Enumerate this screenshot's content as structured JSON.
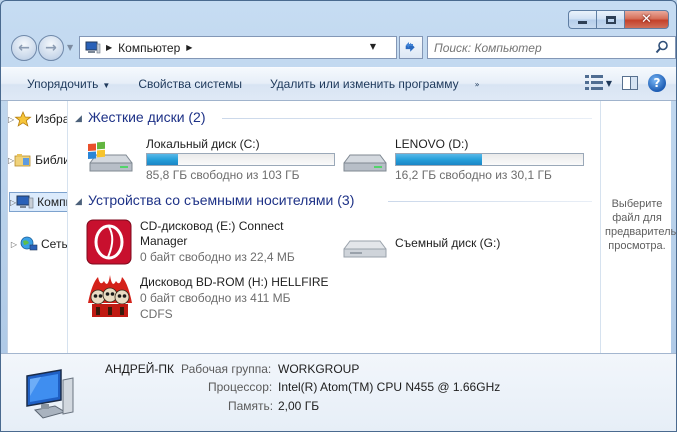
{
  "window": {
    "close_glyph": "✕"
  },
  "nav": {
    "address_text": "Компьютер",
    "search_placeholder": "Поиск: Компьютер"
  },
  "toolbar": {
    "organize": "Упорядочить",
    "system_properties": "Свойства системы",
    "uninstall": "Удалить или изменить программу"
  },
  "sidebar": {
    "items": [
      {
        "label": "Избранное",
        "icon": "star-icon"
      },
      {
        "label": "Библиотеки",
        "icon": "libraries-icon"
      },
      {
        "label": "Компьютер",
        "icon": "computer-icon",
        "selected": true
      },
      {
        "label": "Сеть",
        "icon": "network-icon"
      }
    ]
  },
  "groups": {
    "hard_drives": {
      "title": "Жесткие диски (2)",
      "drives": [
        {
          "name": "Локальный диск (C:)",
          "free": "85,8 ГБ свободно из 103 ГБ",
          "used_fraction": 0.167,
          "icon": "windows-drive-icon"
        },
        {
          "name": "LENOVO (D:)",
          "free": "16,2 ГБ свободно из 30,1 ГБ",
          "used_fraction": 0.462,
          "icon": "hard-drive-icon"
        }
      ]
    },
    "removable": {
      "title": "Устройства со съемными носителями (3)",
      "devices": [
        {
          "name_line1": "CD-дисковод (E:) Connect",
          "name_line2": "Manager",
          "free": "0 байт свободно из 22,4 МБ",
          "icon": "connect-manager-icon"
        },
        {
          "name": "Съемный диск (G:)",
          "icon": "removable-drive-icon"
        },
        {
          "name": "Дисковод BD-ROM (H:) HELLFIRE",
          "free": "0 байт свободно из 411 МБ",
          "fs": "CDFS",
          "icon": "hellfire-icon"
        }
      ]
    }
  },
  "preview": {
    "text": "Выберите файл для предварительного просмотра."
  },
  "details": {
    "computer_name": "АНДРЕЙ-ПК",
    "workgroup_label": "Рабочая группа:",
    "workgroup_value": "WORKGROUP",
    "cpu_label": "Процессор:",
    "cpu_value": "Intel(R) Atom(TM) CPU N455   @ 1.66GHz",
    "ram_label": "Память:",
    "ram_value": "2,00 ГБ"
  },
  "colors": {
    "bar_fill": "#26a0da",
    "group_header": "#1e3287"
  }
}
